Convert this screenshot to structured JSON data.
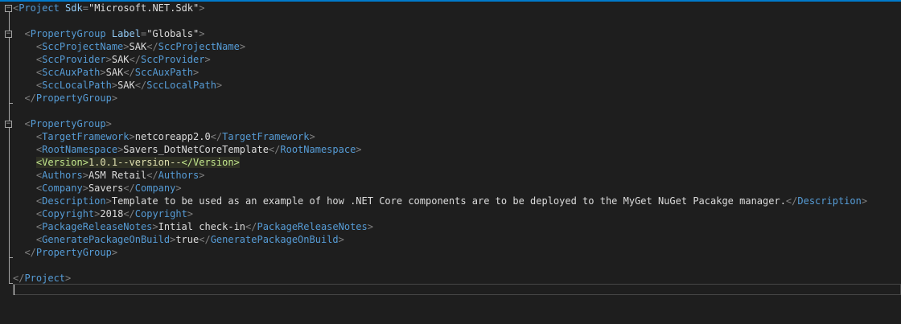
{
  "code": {
    "project_open_lt": "<",
    "project_open_tag": "Project",
    "project_attr_name": "Sdk",
    "project_attr_eq": "=",
    "project_attr_value": "\"Microsoft.NET.Sdk\"",
    "project_open_gt": ">",
    "pg1_lt": "<",
    "pg1_tag": "PropertyGroup",
    "pg1_attr_name": "Label",
    "pg1_attr_eq": "=",
    "pg1_attr_value": "\"Globals\"",
    "pg1_gt": ">",
    "scc_project_name_open": "SccProjectName",
    "scc_project_name_value": "SAK",
    "scc_provider_open": "SccProvider",
    "scc_provider_value": "SAK",
    "scc_aux_path_open": "SccAuxPath",
    "scc_aux_path_value": "SAK",
    "scc_local_path_open": "SccLocalPath",
    "scc_local_path_value": "SAK",
    "pg1_close": "PropertyGroup",
    "pg2_open": "PropertyGroup",
    "target_framework_tag": "TargetFramework",
    "target_framework_value": "netcoreapp2.0",
    "root_namespace_tag": "RootNamespace",
    "root_namespace_value": "Savers_DotNetCoreTemplate",
    "version_tag": "Version",
    "version_value": "1.0.1--version--",
    "authors_tag": "Authors",
    "authors_value": "ASM Retail",
    "company_tag": "Company",
    "company_value": "Savers",
    "description_tag": "Description",
    "description_value": "Template to be used as an example of how .NET Core components are to be deployed to the MyGet NuGet Pacakge manager.",
    "copyright_tag": "Copyright",
    "copyright_value": "2018",
    "release_notes_tag": "PackageReleaseNotes",
    "release_notes_value": "Intial check-in",
    "generate_package_tag": "GeneratePackageOnBuild",
    "generate_package_value": "true",
    "pg2_close": "PropertyGroup",
    "project_close": "Project",
    "lt": "<",
    "lt_slash": "</",
    "gt": ">",
    "fold_minus": "−"
  },
  "colors": {
    "background": "#1e1e1e",
    "delimiter": "#808080",
    "tag_name": "#569cd6",
    "attribute_name": "#92caf4",
    "text": "#dcdcdc",
    "highlight": "#c3e88d",
    "accent_bar": "#007acc"
  }
}
